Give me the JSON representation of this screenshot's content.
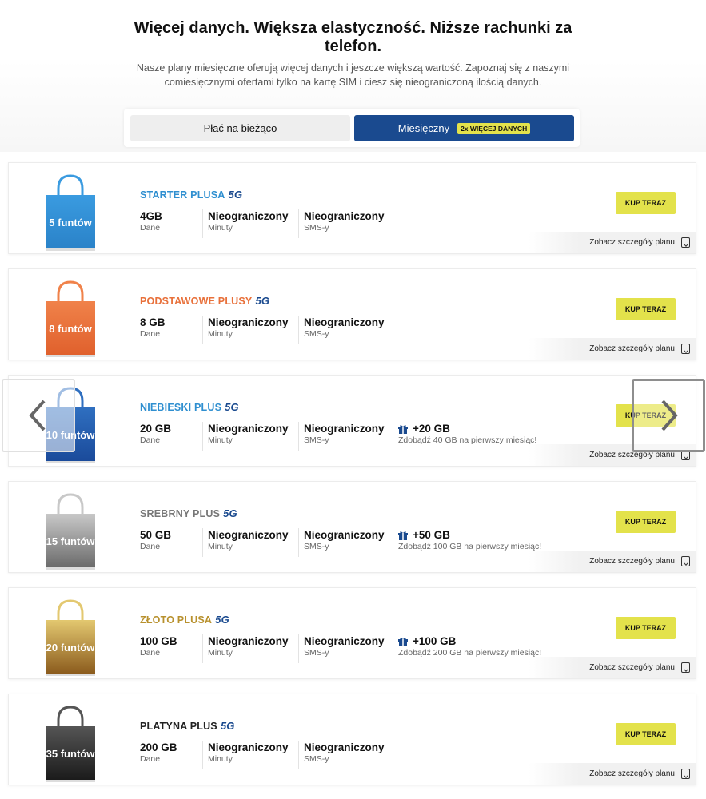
{
  "header": {
    "headline": "Więcej danych. Większa elastyczność. Niższe rachunki za telefon.",
    "subtitle": "Nasze plany miesięczne oferują więcej danych i jeszcze większą wartość. Zapoznaj się z naszymi comiesięcznymi ofertami tylko na kartę SIM i ciesz się nieograniczoną ilością danych."
  },
  "toggle": {
    "payg_label": "Płać na bieżąco",
    "monthly_label": "Miesięczny",
    "monthly_badge": "2x WIĘCEJ DANYCH"
  },
  "labels": {
    "data": "Dane",
    "minutes": "Minuty",
    "sms": "SMS-y",
    "buy": "KUP TERAZ",
    "details": "Zobacz szczegóły planu",
    "g5": "5G"
  },
  "colors": {
    "primary": "#1a4a8f",
    "accent_yellow": "#e3e24b"
  },
  "plans": [
    {
      "name": "STARTER PLUSA",
      "name_color": "#2f8fd0",
      "price": "5 funtów",
      "bag_top": "#3a9be0",
      "bag_bottom": "#2a82c8",
      "data": "4GB",
      "minutes": "Nieograniczony",
      "sms": "Nieograniczony"
    },
    {
      "name": "PODSTAWOWE PLUSY",
      "name_color": "#e8703a",
      "price": "8 funtów",
      "bag_top": "#f0824a",
      "bag_bottom": "#e0602c",
      "data": "8 GB",
      "minutes": "Nieograniczony",
      "sms": "Nieograniczony"
    },
    {
      "name": "NIEBIESKI PLUS",
      "name_color": "#2f8fd0",
      "price": "10 funtów",
      "bag_top": "#2f6fc0",
      "bag_bottom": "#1a4a9a",
      "data": "20 GB",
      "minutes": "Nieograniczony",
      "sms": "Nieograniczony",
      "bonus": "+20 GB",
      "bonus_note": "Zdobądź 40 GB na pierwszy miesiąc!"
    },
    {
      "name": "SREBRNY PLUS",
      "name_color": "#777777",
      "price": "15 funtów",
      "bag_top": "#c8c8c8",
      "bag_bottom": "#6a6a6a",
      "data": "50 GB",
      "minutes": "Nieograniczony",
      "sms": "Nieograniczony",
      "bonus": "+50 GB",
      "bonus_note": "Zdobądź 100 GB na pierwszy miesiąc!"
    },
    {
      "name": "ZŁOTO PLUSA",
      "name_color": "#b8912e",
      "price": "20 funtów",
      "bag_top": "#e3c870",
      "bag_bottom": "#8a5a1c",
      "data": "100 GB",
      "minutes": "Nieograniczony",
      "sms": "Nieograniczony",
      "bonus": "+100 GB",
      "bonus_note": "Zdobądź 200 GB na pierwszy miesiąc!"
    },
    {
      "name": "PLATYNA PLUS",
      "name_color": "#222222",
      "price": "35 funtów",
      "bag_top": "#555555",
      "bag_bottom": "#1a1a1a",
      "data": "200 GB",
      "minutes": "Nieograniczony",
      "sms": "Nieograniczony"
    }
  ],
  "carousel": {
    "prev_icon": "chevron-left-icon",
    "next_icon": "chevron-right-icon"
  }
}
